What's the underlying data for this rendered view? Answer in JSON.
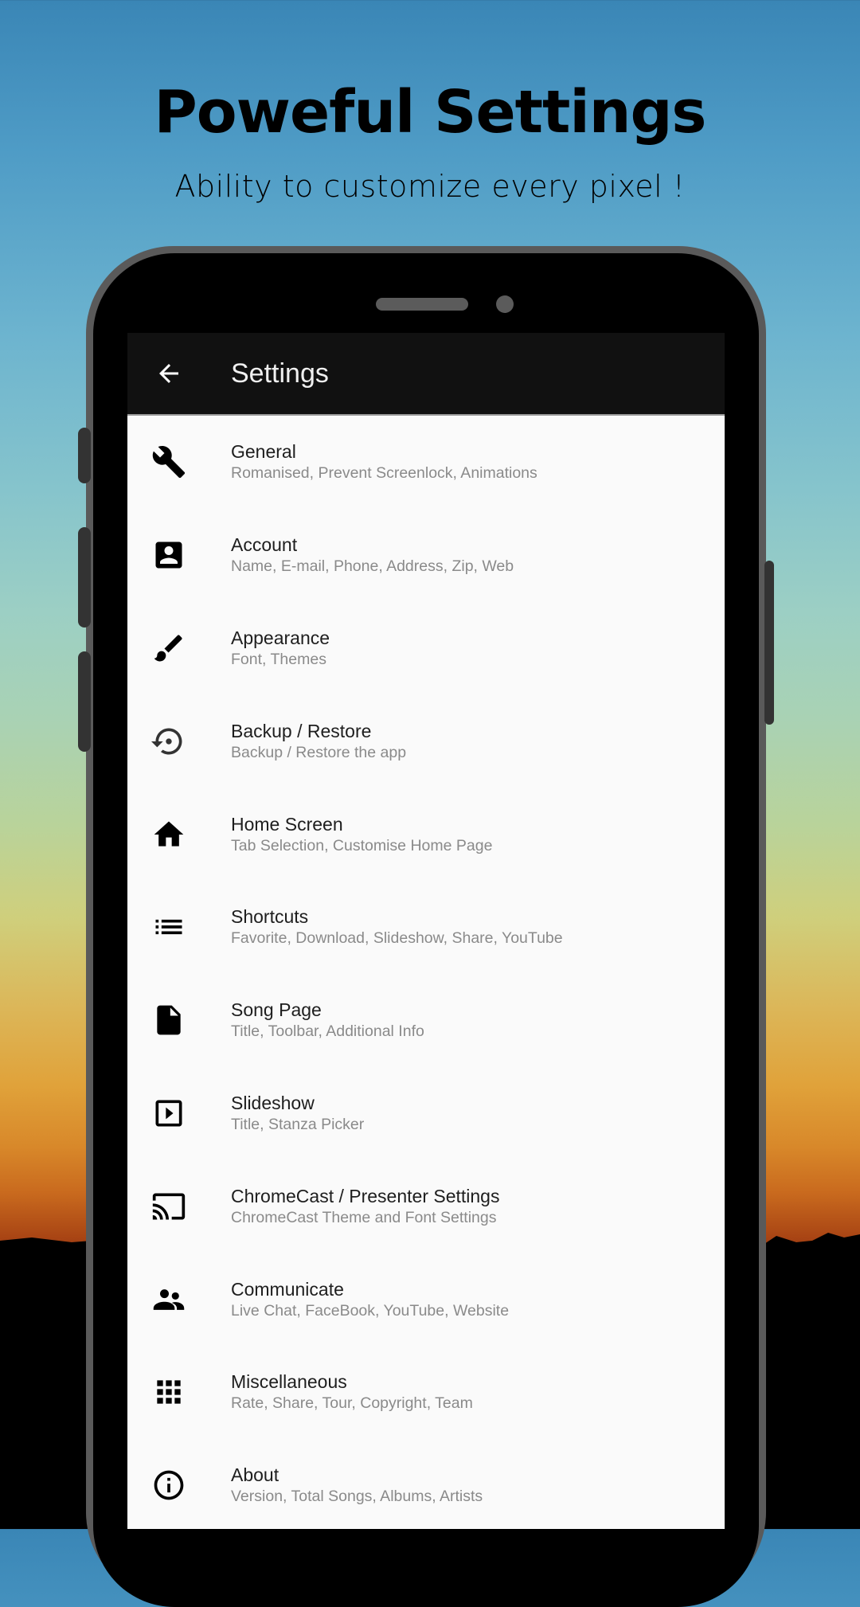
{
  "promo": {
    "headline": "Poweful Settings",
    "subline": "Ability to customize every pixel !"
  },
  "appbar": {
    "back_icon": "arrow-left-icon",
    "title": "Settings"
  },
  "settings": {
    "items": [
      {
        "icon": "wrench-icon",
        "title": "General",
        "subtitle": "Romanised, Prevent Screenlock, Animations"
      },
      {
        "icon": "account-box-icon",
        "title": "Account",
        "subtitle": "Name, E-mail, Phone, Address, Zip, Web"
      },
      {
        "icon": "brush-icon",
        "title": "Appearance",
        "subtitle": "Font, Themes"
      },
      {
        "icon": "restore-icon",
        "title": "Backup / Restore",
        "subtitle": "Backup / Restore the app"
      },
      {
        "icon": "home-icon",
        "title": "Home Screen",
        "subtitle": "Tab Selection, Customise Home Page"
      },
      {
        "icon": "list-icon",
        "title": "Shortcuts",
        "subtitle": "Favorite, Download, Slideshow, Share, YouTube"
      },
      {
        "icon": "file-icon",
        "title": "Song Page",
        "subtitle": "Title, Toolbar, Additional Info"
      },
      {
        "icon": "slideshow-icon",
        "title": "Slideshow",
        "subtitle": "Title, Stanza Picker"
      },
      {
        "icon": "cast-icon",
        "title": "ChromeCast / Presenter Settings",
        "subtitle": "ChromeCast Theme and Font Settings"
      },
      {
        "icon": "people-icon",
        "title": "Communicate",
        "subtitle": "Live Chat, FaceBook, YouTube, Website"
      },
      {
        "icon": "apps-grid-icon",
        "title": "Miscellaneous",
        "subtitle": "Rate, Share, Tour, Copyright, Team"
      },
      {
        "icon": "info-icon",
        "title": "About",
        "subtitle": "Version, Total Songs, Albums, Artists"
      }
    ]
  },
  "colors": {
    "appbar": "#111111",
    "list_background": "#fafafa",
    "title_text": "#1e1e1e",
    "subtitle_text": "#8a8a8a"
  }
}
